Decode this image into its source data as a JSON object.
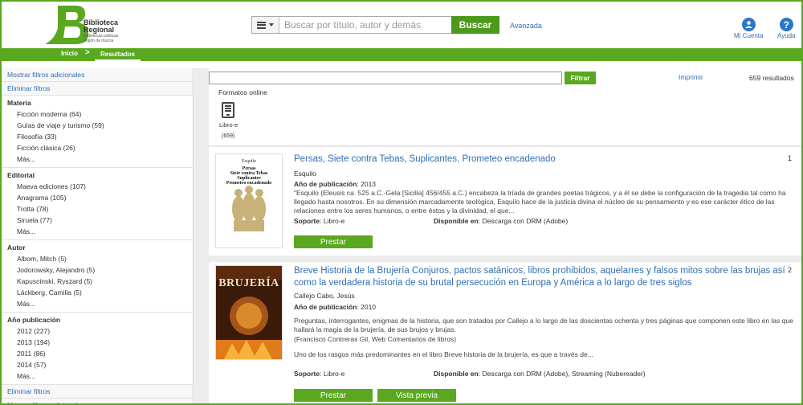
{
  "header": {
    "logo_line1": "Biblioteca",
    "logo_line2": "Regional",
    "logo_line3": "bibliotecas públicas",
    "logo_line4": "región de murcia",
    "search_placeholder": "Buscar por título, autor y demás",
    "search_button": "Buscar",
    "advanced_link": "Avanzada",
    "account_label": "Mi Cuenta",
    "help_label": "Ayuda",
    "help_glyph": "?",
    "brand_green": "#5aa81f",
    "link_blue": "#2f6fb3"
  },
  "nav": {
    "home": "Inicio",
    "separator": ">",
    "results": "Resultados"
  },
  "sidebar": {
    "show_filters": "Mostrar filtros adicionales",
    "remove_filters": "Eliminar filtros",
    "groups": [
      {
        "title": "Materia",
        "items": [
          "Ficción moderna (64)",
          "Guías de viaje y turismo (59)",
          "Filosofía (33)",
          "Ficción clásica (26)"
        ],
        "more": "Más..."
      },
      {
        "title": "Editorial",
        "items": [
          "Maeva ediciones (107)",
          "Anagrama (105)",
          "Trotta (78)",
          "Siruela (77)"
        ],
        "more": "Más..."
      },
      {
        "title": "Autor",
        "items": [
          "Albom, Mitch (5)",
          "Jodorowsky, Alejandro (5)",
          "Kapuscinski, Ryszard (5)",
          "Läckberg, Camilla (5)"
        ],
        "more": "Más..."
      },
      {
        "title": "Año publicación",
        "items": [
          "2012 (227)",
          "2013 (194)",
          "2011 (86)",
          "2014 (57)"
        ],
        "more": "Más..."
      }
    ],
    "remove_filters_bottom": "Eliminar filtros",
    "show_filters_bottom": "Mostrar filtros adicionales"
  },
  "toolbar": {
    "filter_button": "Filtrar",
    "print_link": "Imprimir",
    "results_count": "659 resultados",
    "formats_label": "Formatos online",
    "ebook_label": "Libro-e",
    "ebook_count": "(659)"
  },
  "results": [
    {
      "num": "1",
      "title": "Persas, Siete contra Tebas, Suplicantes, Prometeo encadenado",
      "author": "Esquilo",
      "year_label": "Año de publicación",
      "year": ": 2013",
      "description": "\"Esquilo (Eleusis ca. 525 a.C.-Gela [Sicilia] 456/455 a.C.) encabeza la tríada de grandes poetas trágicos, y a él se debe la configuración de la tragedia tal como ha llegado hasta nosotros. En su dimensión marcadamente teológica, Esquilo hace de la justicia divina el núcleo de su pensamiento y es ese carácter ético de las relaciones entre los seres humanos, o entre éstos y la divinidad, el que...",
      "support_label": "Soporte",
      "support": ": Libro-e",
      "available_label": "Disponible en",
      "available": ": Descarga con DRM (Adobe)",
      "borrow": "Prestar",
      "cover_author": "Esquilo",
      "cover_title": "Persas\nSiete contra Tebas\nSuplicantes\nPrometeo encadenado"
    },
    {
      "num": "2",
      "title": "Breve Historia de la Brujería Conjuros, pactos satánicos, libros prohibidos, aquelarres y falsos mitos sobre las brujas así como la verdadera historia de su brutal persecución en Europa y América a lo largo de tres siglos",
      "author": "Callejo Cabo, Jesús",
      "year_label": "Año de publicación",
      "year": ": 2010",
      "description": "Preguntas, interrogantes, enigmas de la historia, que son tratados por Callejo a lo largo de las doscientas ochenta y tres páginas que componen este libro en las que hallará la magia de la brujería, de sus brujos y brujas.",
      "description2": "(Francisco Contreras Gil, Web Comentarios de libros)",
      "description3": "Uno de los rasgos más predominantes en el libro Breve historia de la brujería, es que a través de...",
      "support_label": "Soporte",
      "support": ": Libro-e",
      "available_label": "Disponible en",
      "available": ": Descarga con DRM (Adobe), Streaming (Nubereader)",
      "borrow": "Prestar",
      "preview": "Vista previa",
      "cover_title": "BRUJERÍA"
    }
  ]
}
